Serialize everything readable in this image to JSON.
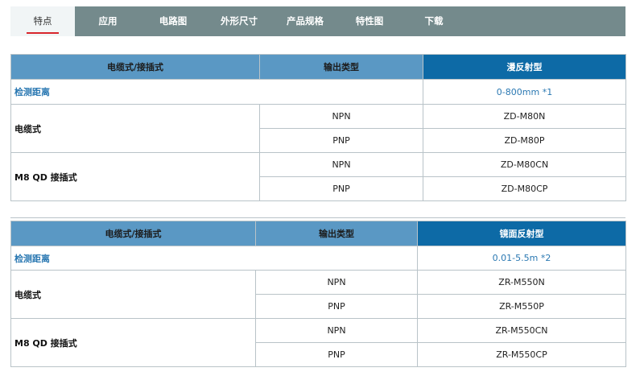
{
  "tabs": [
    {
      "label": "特点",
      "active": true
    },
    {
      "label": "应用"
    },
    {
      "label": "电路图"
    },
    {
      "label": "外形尺寸"
    },
    {
      "label": "产品规格"
    },
    {
      "label": "特性图"
    },
    {
      "label": "下载"
    }
  ],
  "table1": {
    "header": {
      "type": "电缆式/接插式",
      "output": "输出类型",
      "model": "漫反射型"
    },
    "distance": {
      "label": "检测距离",
      "value": "0-800mm *1"
    },
    "groups": [
      {
        "label": "电缆式",
        "rows": [
          {
            "output": "NPN",
            "model": "ZD-M80N"
          },
          {
            "output": "PNP",
            "model": "ZD-M80P"
          }
        ]
      },
      {
        "label": "M8 QD 接插式",
        "rows": [
          {
            "output": "NPN",
            "model": "ZD-M80CN"
          },
          {
            "output": "PNP",
            "model": "ZD-M80CP"
          }
        ]
      }
    ]
  },
  "table2": {
    "header": {
      "type": "电缆式/接插式",
      "output": "输出类型",
      "model": "镜面反射型"
    },
    "distance": {
      "label": "检测距离",
      "value": "0.01-5.5m *2"
    },
    "groups": [
      {
        "label": "电缆式",
        "rows": [
          {
            "output": "NPN",
            "model": "ZR-M550N"
          },
          {
            "output": "PNP",
            "model": "ZR-M550P"
          }
        ]
      },
      {
        "label": "M8 QD 接插式",
        "rows": [
          {
            "output": "NPN",
            "model": "ZR-M550CN"
          },
          {
            "output": "PNP",
            "model": "ZR-M550CP"
          }
        ]
      }
    ]
  },
  "colors": {
    "tabbar": "#748a8c",
    "active_underline": "#d8262d",
    "header": "#5a98c4",
    "header_accent": "#0d6aa6",
    "link_blue": "#2a78b2"
  }
}
